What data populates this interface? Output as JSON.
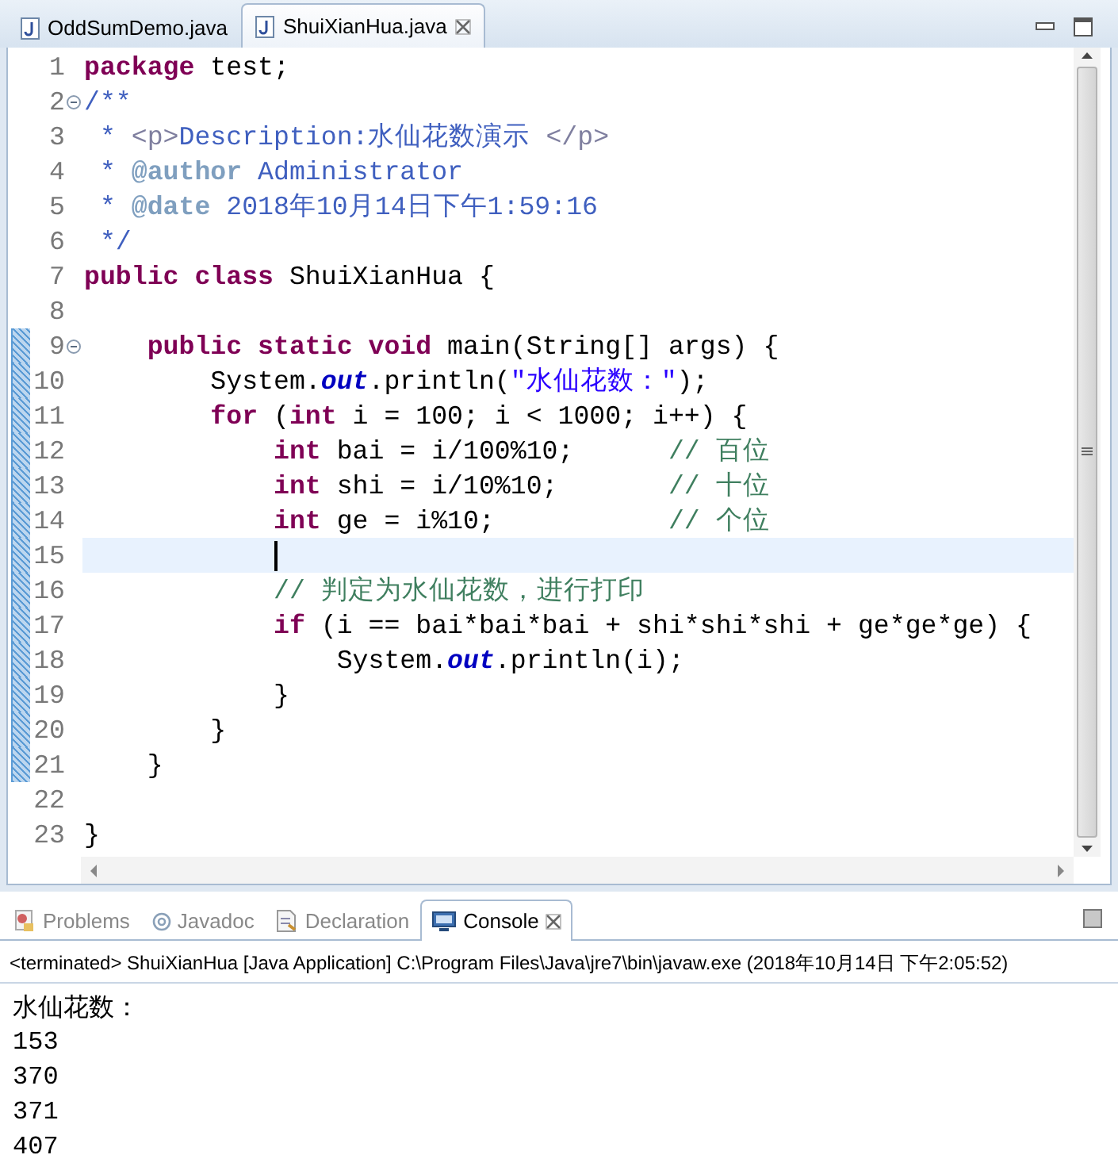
{
  "editor": {
    "tabs": [
      {
        "label": "OddSumDemo.java",
        "selected": false
      },
      {
        "label": "ShuiXianHua.java",
        "selected": true
      }
    ],
    "lines": [
      {
        "number": "1",
        "changed": false,
        "current": false,
        "foldable": false,
        "tokens": [
          {
            "kind": "keyword",
            "text": "package"
          },
          {
            "kind": "plain",
            "text": " test;"
          }
        ]
      },
      {
        "number": "2",
        "changed": false,
        "current": false,
        "foldable": true,
        "tokens": [
          {
            "kind": "javadoc",
            "text": "/**"
          }
        ]
      },
      {
        "number": "3",
        "changed": false,
        "current": false,
        "foldable": false,
        "tokens": [
          {
            "kind": "javadoc",
            "text": " * "
          },
          {
            "kind": "html_tag",
            "text": "<p>"
          },
          {
            "kind": "javadoc",
            "text": "Description:水仙花数演示 "
          },
          {
            "kind": "html_tag",
            "text": "</p>"
          }
        ]
      },
      {
        "number": "4",
        "changed": false,
        "current": false,
        "foldable": false,
        "tokens": [
          {
            "kind": "javadoc",
            "text": " * "
          },
          {
            "kind": "javadoc_tag",
            "text": "@author"
          },
          {
            "kind": "javadoc",
            "text": " Administrator"
          }
        ]
      },
      {
        "number": "5",
        "changed": false,
        "current": false,
        "foldable": false,
        "tokens": [
          {
            "kind": "javadoc",
            "text": " * "
          },
          {
            "kind": "javadoc_tag",
            "text": "@date"
          },
          {
            "kind": "javadoc",
            "text": " 2018年10月14日下午1:59:16"
          }
        ]
      },
      {
        "number": "6",
        "changed": false,
        "current": false,
        "foldable": false,
        "tokens": [
          {
            "kind": "javadoc",
            "text": " */"
          }
        ]
      },
      {
        "number": "7",
        "changed": false,
        "current": false,
        "foldable": false,
        "tokens": [
          {
            "kind": "keyword",
            "text": "public class"
          },
          {
            "kind": "plain",
            "text": " ShuiXianHua {"
          }
        ]
      },
      {
        "number": "8",
        "changed": false,
        "current": false,
        "foldable": false
      },
      {
        "number": "9",
        "changed": true,
        "current": false,
        "foldable": true,
        "tokens": [
          {
            "kind": "keyword",
            "text": "    public static void"
          },
          {
            "kind": "plain",
            "text": " main(String[] args) {"
          }
        ]
      },
      {
        "number": "10",
        "changed": true,
        "current": false,
        "foldable": false,
        "tokens": [
          {
            "kind": "plain",
            "text": "        System."
          },
          {
            "kind": "field",
            "text": "out"
          },
          {
            "kind": "plain",
            "text": ".println("
          },
          {
            "kind": "string",
            "text": "\"水仙花数：\""
          },
          {
            "kind": "plain",
            "text": ");"
          }
        ]
      },
      {
        "number": "11",
        "changed": true,
        "current": false,
        "foldable": false,
        "tokens": [
          {
            "kind": "keyword",
            "text": "        for"
          },
          {
            "kind": "plain",
            "text": " ("
          },
          {
            "kind": "keyword",
            "text": "int"
          },
          {
            "kind": "plain",
            "text": " i = 100; i < 1000; i++) {"
          }
        ]
      },
      {
        "number": "12",
        "changed": true,
        "current": false,
        "foldable": false,
        "tokens": [
          {
            "kind": "keyword",
            "text": "            int"
          },
          {
            "kind": "plain",
            "text": " bai = i/100%10;      "
          },
          {
            "kind": "comment",
            "text": "// 百位"
          }
        ]
      },
      {
        "number": "13",
        "changed": true,
        "current": false,
        "foldable": false,
        "tokens": [
          {
            "kind": "keyword",
            "text": "            int"
          },
          {
            "kind": "plain",
            "text": " shi = i/10%10;       "
          },
          {
            "kind": "comment",
            "text": "// 十位"
          }
        ]
      },
      {
        "number": "14",
        "changed": true,
        "current": false,
        "foldable": false,
        "tokens": [
          {
            "kind": "keyword",
            "text": "            int"
          },
          {
            "kind": "plain",
            "text": " ge = i%10;           "
          },
          {
            "kind": "comment",
            "text": "// 个位"
          }
        ]
      },
      {
        "number": "15",
        "changed": true,
        "current": true,
        "foldable": false
      },
      {
        "number": "16",
        "changed": true,
        "current": false,
        "foldable": false,
        "tokens": [
          {
            "kind": "comment",
            "text": "            // 判定为水仙花数，进行打印"
          }
        ]
      },
      {
        "number": "17",
        "changed": true,
        "current": false,
        "foldable": false,
        "tokens": [
          {
            "kind": "keyword",
            "text": "            if"
          },
          {
            "kind": "plain",
            "text": " (i == bai*bai*bai + shi*shi*shi + ge*ge*ge) {"
          }
        ]
      },
      {
        "number": "18",
        "changed": true,
        "current": false,
        "foldable": false,
        "tokens": [
          {
            "kind": "plain",
            "text": "                System."
          },
          {
            "kind": "field",
            "text": "out"
          },
          {
            "kind": "plain",
            "text": ".println(i);"
          }
        ]
      },
      {
        "number": "19",
        "changed": true,
        "current": false,
        "foldable": false,
        "tokens": [
          {
            "kind": "plain",
            "text": "            }"
          }
        ]
      },
      {
        "number": "20",
        "changed": true,
        "current": false,
        "foldable": false,
        "tokens": [
          {
            "kind": "plain",
            "text": "        }"
          }
        ]
      },
      {
        "number": "21",
        "changed": true,
        "current": false,
        "foldable": false,
        "tokens": [
          {
            "kind": "plain",
            "text": "    }"
          }
        ]
      },
      {
        "number": "22",
        "changed": false,
        "current": false,
        "foldable": false
      },
      {
        "number": "23",
        "changed": false,
        "current": false,
        "foldable": false,
        "tokens": [
          {
            "kind": "plain",
            "text": "}"
          }
        ]
      }
    ]
  },
  "console": {
    "tabs": [
      {
        "label": "Problems",
        "selected": false
      },
      {
        "label": "Javadoc",
        "selected": false
      },
      {
        "label": "Declaration",
        "selected": false
      },
      {
        "label": "Console",
        "selected": true
      }
    ],
    "header": "<terminated> ShuiXianHua [Java Application] C:\\Program Files\\Java\\jre7\\bin\\javaw.exe (2018年10月14日 下午2:05:52)",
    "output": [
      "水仙花数：",
      "153",
      "370",
      "371",
      "407"
    ]
  }
}
